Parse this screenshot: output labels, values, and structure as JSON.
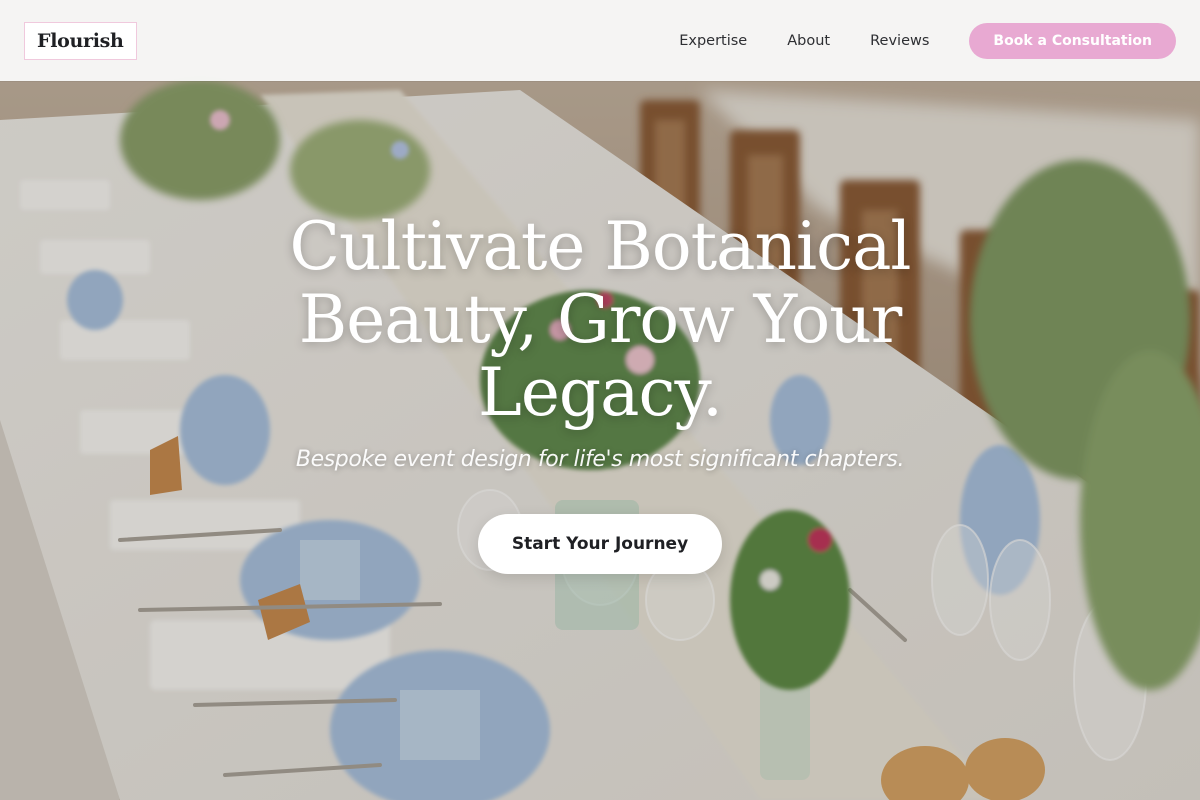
{
  "header": {
    "logo_text": "Flourish",
    "nav": [
      {
        "label": "Expertise"
      },
      {
        "label": "About"
      },
      {
        "label": "Reviews"
      }
    ],
    "cta_label": "Book a Consultation"
  },
  "hero": {
    "title": "Cultivate Botanical Beauty, Grow Your Legacy.",
    "subtitle": "Bespoke event design for life's most significant chapters.",
    "cta_label": "Start Your Journey",
    "background_image": "banquet-table-with-flowers-photo"
  },
  "colors": {
    "accent_pink": "#e8a9d2",
    "logo_border": "#f0c9dd",
    "text_dark": "#1f2024",
    "header_bg": "#fafafa"
  }
}
